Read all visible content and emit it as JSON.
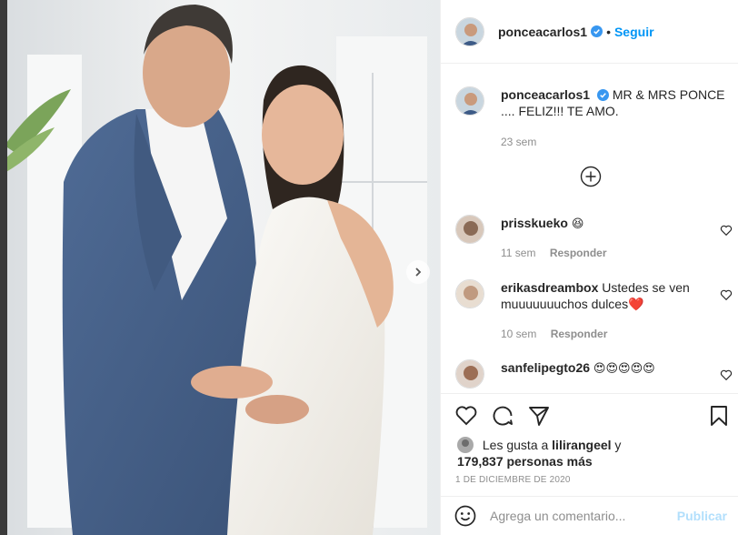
{
  "post": {
    "image_alt": "Foto de boda: hombre con traje azul y mujer con vestido blanco",
    "author": "ponceacarlos1",
    "follow_label": "Seguir",
    "dot": "•",
    "caption_user": "ponceacarlos1",
    "caption_text": "MR & MRS PONCE .... FELIZ!!! TE AMO.",
    "caption_time": "23 sem"
  },
  "comments": [
    {
      "user": "prisskueko",
      "text": "😆",
      "time": "11 sem",
      "reply": "Responder"
    },
    {
      "user": "erikasdreambox",
      "text": "Ustedes se ven muuuuuuuchos dulces❤️",
      "time": "10 sem",
      "reply": "Responder"
    },
    {
      "user": "sanfelipegto26",
      "text": "😍😍😍😍😍",
      "time": "",
      "reply": ""
    }
  ],
  "likes": {
    "prefix": "Les gusta a",
    "user": "lilirangeel",
    "conj": "y",
    "count": "179,837 personas más"
  },
  "date": "1 DE DICIEMBRE DE 2020",
  "composer": {
    "placeholder": "Agrega un comentario...",
    "publish_label": "Publicar"
  },
  "icons": [
    "chevron-right-icon",
    "verified-icon",
    "plus-circle-icon",
    "heart-icon",
    "comment-icon",
    "share-icon",
    "bookmark-icon",
    "emoji-icon"
  ],
  "colors": {
    "link": "#0095f6",
    "verified": "#3897f0",
    "publish_disabled": "#b2dffc",
    "meta": "#8e8e8e",
    "heart_red": "#e0245e"
  }
}
